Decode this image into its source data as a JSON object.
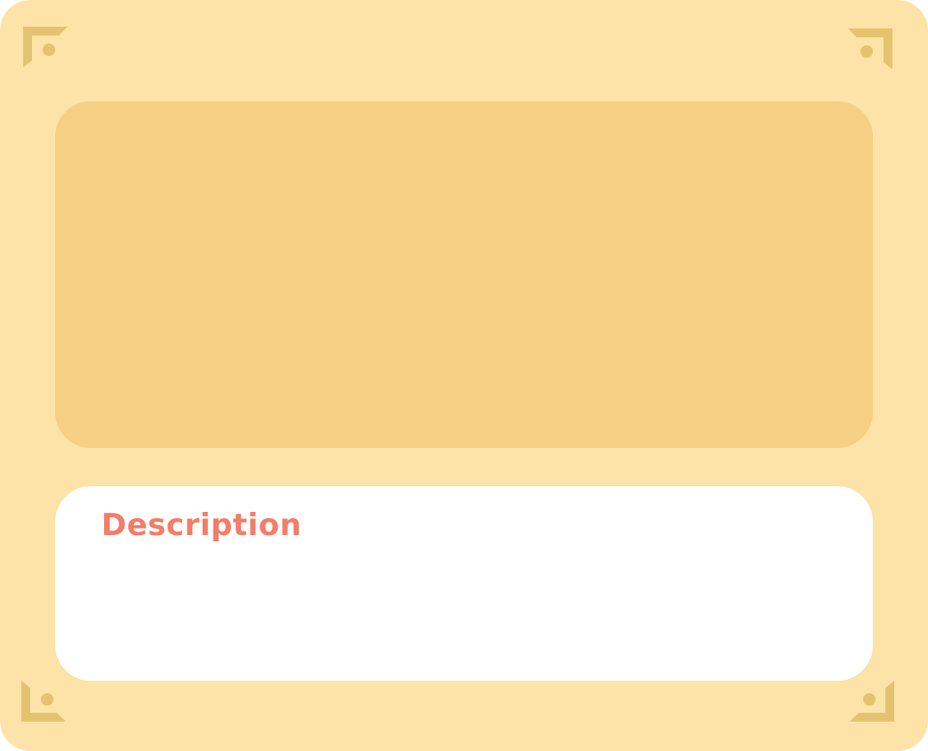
{
  "colors": {
    "frame_bg": "#fde3a7",
    "frame_ornament": "#e3c36f",
    "image_panel_bg": "#f7cf84",
    "description_panel_bg": "#ffffff",
    "description_title_color": "#f47d68"
  },
  "description": {
    "title": "Description",
    "body": ""
  },
  "ornaments": {
    "icon": "corner-bracket-icon",
    "count": 4
  }
}
